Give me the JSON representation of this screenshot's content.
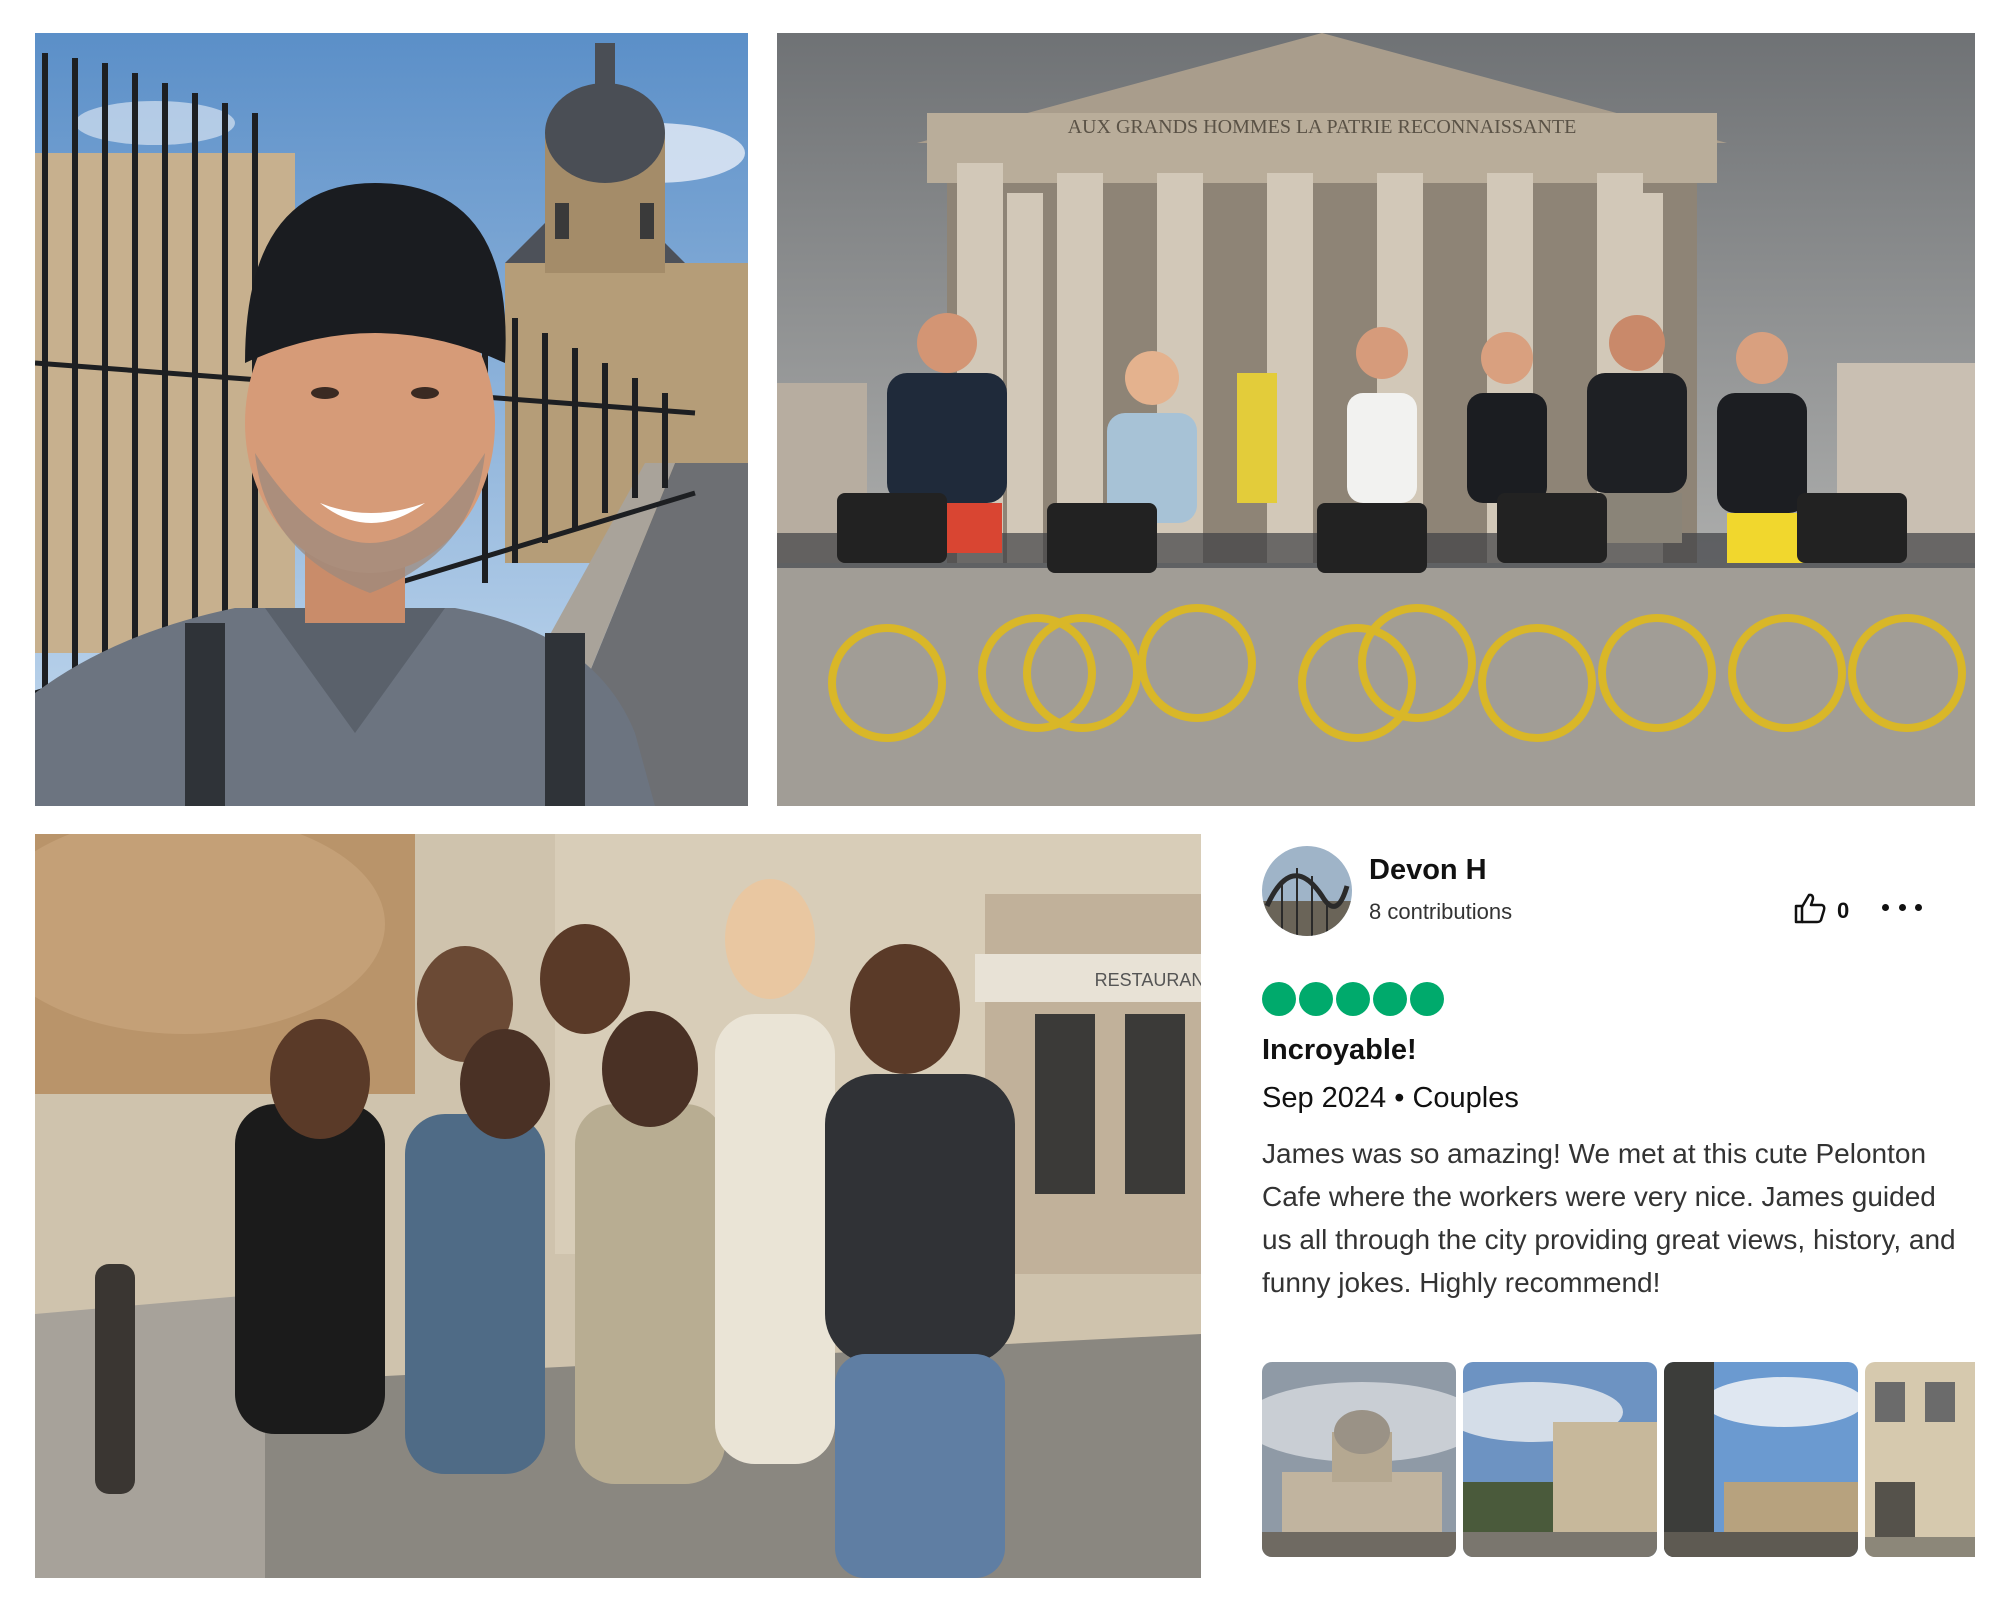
{
  "photos": {
    "selfie": "selfie-photo",
    "bikes": "pantheon-bikes-photo",
    "group": "group-photo"
  },
  "pantheon_inscription": "AUX GRANDS HOMMES LA PATRIE RECONNAISSANTE",
  "storefront_sign": "RESTAURANT",
  "review": {
    "reviewer_name": "Devon H",
    "contributions": "8 contributions",
    "helpful_count": "0",
    "rating": 5,
    "title": "Incroyable!",
    "meta": "Sep 2024 • Couples",
    "body": "James was so amazing! We met at this cute Pelonton Cafe where the workers were very nice. James guided us all through the city providing great views, history, and funny jokes. Highly recommend!",
    "icons": {
      "helpful": "thumbs-up-icon",
      "more": "more-options-icon"
    },
    "colors": {
      "rating_bubble": "#00aa6c",
      "text": "#111111"
    }
  }
}
